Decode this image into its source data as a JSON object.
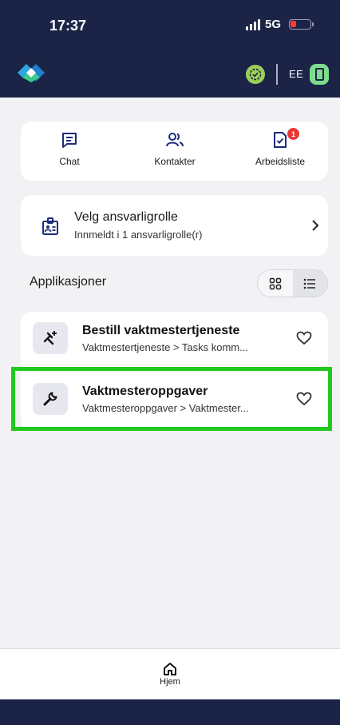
{
  "status_bar": {
    "time": "17:37",
    "network": "5G",
    "battery_color": "#ff3b30"
  },
  "header": {
    "logo_icon": "diamond-logo-icon",
    "user_initials": "EE",
    "status_icon": "check-circle-icon",
    "device_icon": "device-icon",
    "bg_color": "#1b2446"
  },
  "quick_actions": [
    {
      "label": "Chat",
      "icon": "chat-icon"
    },
    {
      "label": "Kontakter",
      "icon": "contacts-icon"
    },
    {
      "label": "Arbeidsliste",
      "icon": "worklist-icon",
      "badge": "1"
    }
  ],
  "role": {
    "title": "Velg ansvarligrolle",
    "subtitle": "Innmeldt i 1 ansvarligrolle(r)",
    "icon": "role-badge-icon"
  },
  "applications": {
    "title": "Applikasjoner",
    "view_toggle": [
      "grid",
      "list"
    ],
    "selected_view": "list",
    "items": [
      {
        "title": "Bestill vaktmestertjeneste",
        "subtitle": "Vaktmestertjeneste > Tasks komm...",
        "icon": "tools-plus-icon"
      },
      {
        "title": "Vaktmesteroppgaver",
        "subtitle": "Vaktmesteroppgaver > Vaktmester...",
        "icon": "wrench-icon"
      }
    ]
  },
  "bottom_nav": {
    "label": "Hjem",
    "icon": "home-icon"
  },
  "highlight_color": "#21c81e"
}
